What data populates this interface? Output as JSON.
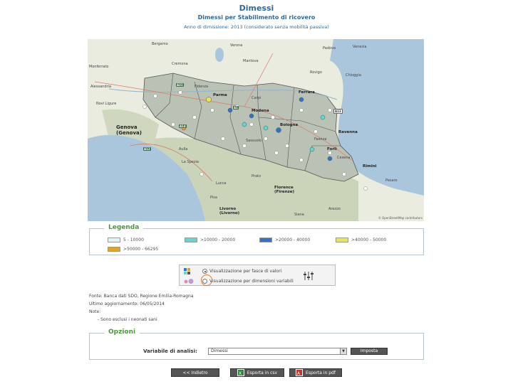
{
  "header": {
    "title": "Dimessi",
    "subtitle": "Dimessi per Stabilimento di ricovero",
    "info": "Anno di dimissione: 2013 (considerato senza mobilità passiva)"
  },
  "map": {
    "labels": {
      "verona": "Verona",
      "mantova": "Mantova",
      "venezia": "Venezia",
      "cremona": "Cremona",
      "padova": "Padova",
      "rovigo": "Rovigo",
      "monferrato": "Monferrato",
      "alessandria": "Alessandria",
      "novi": "Novi Ligure",
      "parma": "Parma",
      "carpi": "Carpi",
      "ferrara": "Ferrara",
      "modena": "Modena",
      "bologna": "Bologna",
      "ravenna": "Ravenna",
      "forli": "Forlì",
      "rimini": "Rimini",
      "pesaro": "Pesaro",
      "genova": "Genova\n(Genova)",
      "laspezia": "La Spezia",
      "lucca": "Lucca",
      "pisa": "Pisa",
      "livorno": "Livorno\n(Livorno)",
      "firenze": "Florence\n(Firenze)",
      "arezzo": "Arezzo",
      "siena": "Siena",
      "chioggia": "Chioggia",
      "bergamo": "Bergamo",
      "sassuolo": "Sassuolo",
      "fidenza": "Fidenza",
      "aulla": "Aulla",
      "faenza": "Faenza",
      "cesena": "Cesena",
      "prato": "Prato"
    },
    "roads": {
      "a21": "A21",
      "a1": "A1",
      "a13": "A13",
      "a12": "A12",
      "a14": "A14"
    },
    "attribution": "© OpenStreetMap contributors"
  },
  "legend": {
    "title": "Legenda",
    "items": [
      {
        "label": "5 - 10000",
        "color": "#dff4f8"
      },
      {
        "label": ">10000 - 20000",
        "color": "#5ed8d0"
      },
      {
        "label": ">20000 - 40000",
        "color": "#2e74c8"
      },
      {
        "label": ">40000 - 50000",
        "color": "#e8e84a"
      },
      {
        "label": ">50000 - 66295",
        "color": "#e0a42a"
      }
    ]
  },
  "visualization": {
    "option1": "Visualizzazione per fasce di valori",
    "option2": "Visualizzazione per dimensioni variabili",
    "selected": "option1"
  },
  "notes": {
    "source": "Fonte: Banca dati SDO, Regione Emilia-Romagna",
    "updated": "Ultimo aggiornamento: 06/05/2014",
    "notes_label": "Note:",
    "note1": "- Sono esclusi i neonati sani"
  },
  "options": {
    "title": "Opzioni",
    "variable_label": "Variabile di analisi:",
    "variable_value": "Dimessi",
    "apply_label": "Imposta"
  },
  "actions": {
    "back_label": "<< Indietro",
    "csv_label": "Esporta in csv",
    "pdf_label": "Esporta in pdf"
  }
}
